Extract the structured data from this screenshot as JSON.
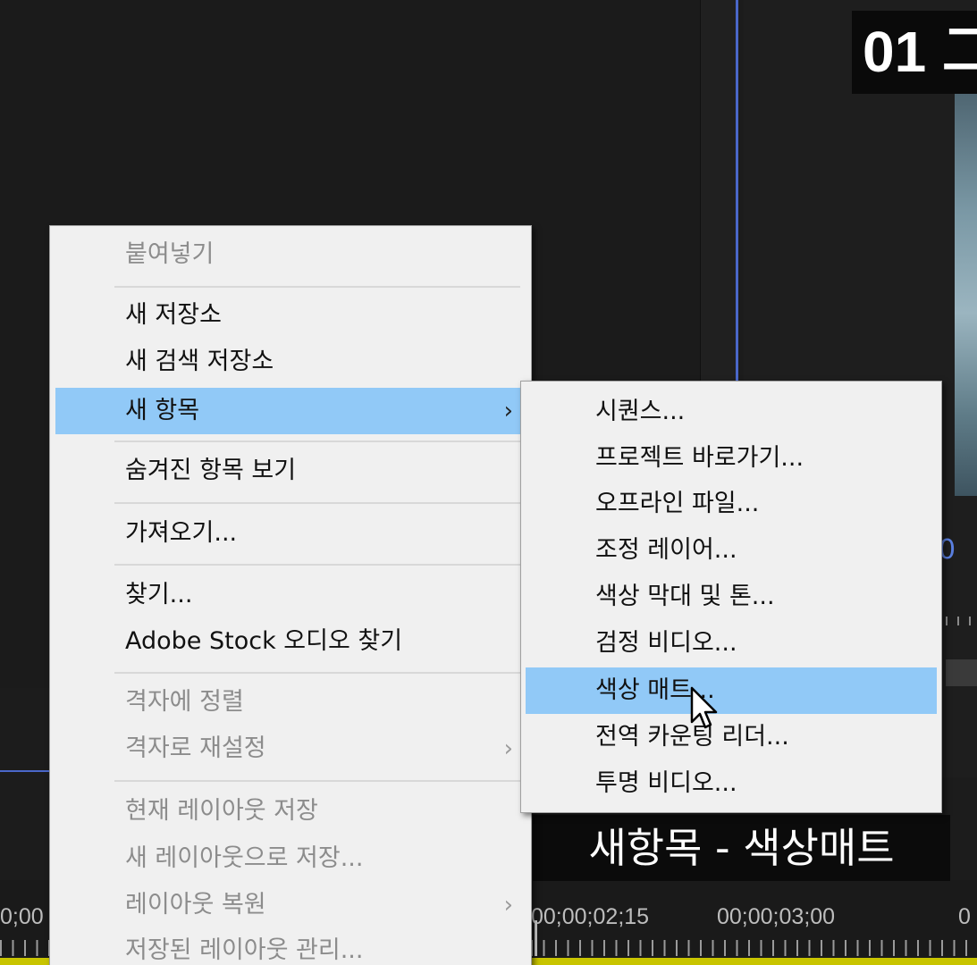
{
  "overlay_title": "01 그",
  "caption": "새항목 - 색상매트",
  "program_monitor": {
    "timecode_fragment": "0"
  },
  "timeline": {
    "timecodes": [
      "0;00",
      "00;00;02;15",
      "00;00;03;00",
      "0"
    ]
  },
  "context_menu": {
    "items": [
      {
        "label": "붙여넣기",
        "disabled": true
      },
      {
        "label": "새 저장소",
        "disabled": false
      },
      {
        "label": "새 검색 저장소",
        "disabled": false
      },
      {
        "label": "새 항목",
        "disabled": false,
        "submenu": true,
        "highlighted": true
      },
      {
        "label": "숨겨진 항목 보기",
        "disabled": false
      },
      {
        "label": "가져오기...",
        "disabled": false
      },
      {
        "label": "찾기...",
        "disabled": false
      },
      {
        "label": "Adobe Stock 오디오 찾기",
        "disabled": false
      },
      {
        "label": "격자에 정렬",
        "disabled": true
      },
      {
        "label": "격자로 재설정",
        "disabled": true,
        "submenu": true
      },
      {
        "label": "현재 레이아웃 저장",
        "disabled": true
      },
      {
        "label": "새 레이아웃으로 저장...",
        "disabled": true
      },
      {
        "label": "레이아웃 복원",
        "disabled": true,
        "submenu": true
      },
      {
        "label": "저장된 레이아웃 관리...",
        "disabled": true
      }
    ],
    "submenu_arrow": "›"
  },
  "submenu": {
    "items": [
      {
        "label": "시퀀스..."
      },
      {
        "label": "프로젝트 바로가기..."
      },
      {
        "label": "오프라인 파일..."
      },
      {
        "label": "조정 레이어..."
      },
      {
        "label": "색상 막대 및 톤..."
      },
      {
        "label": "검정 비디오..."
      },
      {
        "label": "색상 매트...",
        "highlighted": true
      },
      {
        "label": "전역 카운팅 리더..."
      },
      {
        "label": "투명 비디오..."
      }
    ]
  },
  "colors": {
    "menu_background": "#f0f0f0",
    "highlight": "#91c9f7",
    "disabled_text": "#8c8c8c",
    "panel_background": "#1c1c1c",
    "accent_blue": "#4a67c9"
  },
  "icons": [
    "submenu-arrow-icon",
    "mouse-pointer-icon"
  ]
}
